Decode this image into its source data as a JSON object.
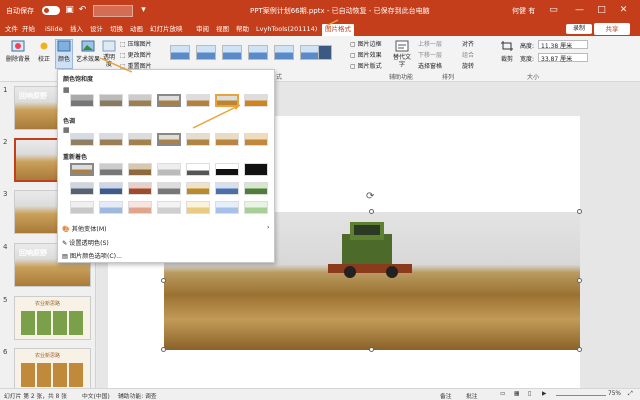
{
  "titlebar": {
    "autosave_label": "自动保存",
    "toggle_state": "关",
    "doc_title": "PPT案例计划66期.pptx - 已自动恢复 - 已保存到此台电脑",
    "user_name": "何健 有",
    "user_initials": "HJ"
  },
  "tabs": [
    "文件",
    "开始",
    "iSlide",
    "插入",
    "设计",
    "切换",
    "动画",
    "幻灯片放映",
    "审阅",
    "视图",
    "帮助",
    "LvyhTools(201114)",
    "图片格式"
  ],
  "active_tab": "图片格式",
  "right_buttons": {
    "record": "录制",
    "share": "共享"
  },
  "ribbon": {
    "remove_bg": "删除背景",
    "correct": "校正",
    "color": "颜色",
    "art_effect": "艺术效果",
    "transparency": "透明度",
    "compress": "压缩图片",
    "change_picture": "更改图片",
    "reset_picture": "重置图片",
    "picture_border": "图片边框",
    "picture_effect": "图片效果",
    "picture_layout": "图片版式",
    "alt_text": "替代文字",
    "alt_text_group": "辅助功能",
    "arrange_group": "排列",
    "up_layer": "上移一层",
    "down_layer": "下移一层",
    "selection_pane": "选择窗格",
    "align": "对齐",
    "group": "组合",
    "rotate": "旋转",
    "crop": "裁剪",
    "size_group": "大小",
    "height_label": "高度:",
    "height_value": "11.38 厘米",
    "width_label": "宽度:",
    "width_value": "33.87 厘米",
    "style_group": "式"
  },
  "dropdown": {
    "saturation_title": "颜色饱和度",
    "tone_title": "色调",
    "recolor_title": "重新着色",
    "more_variations": "其他变体(M)",
    "set_transparent": "设置透明色(S)",
    "color_options": "图片颜色选项(C)..."
  },
  "slides": [
    {
      "num": "1",
      "title": "回响原野"
    },
    {
      "num": "2",
      "title": ""
    },
    {
      "num": "3",
      "title": ""
    },
    {
      "num": "4",
      "title": "回响原野"
    },
    {
      "num": "5",
      "title": "农业新思路"
    },
    {
      "num": "6",
      "title": "农业新思路"
    }
  ],
  "status": {
    "slide_info": "幻灯片 第 2 张，共 8 张",
    "language": "中文(中国)",
    "accessibility": "辅助功能: 调查",
    "notes": "备注",
    "comments": "批注",
    "zoom": "75%"
  },
  "colors": {
    "accent": "#c43e1c",
    "highlight": "#e8a33a"
  }
}
